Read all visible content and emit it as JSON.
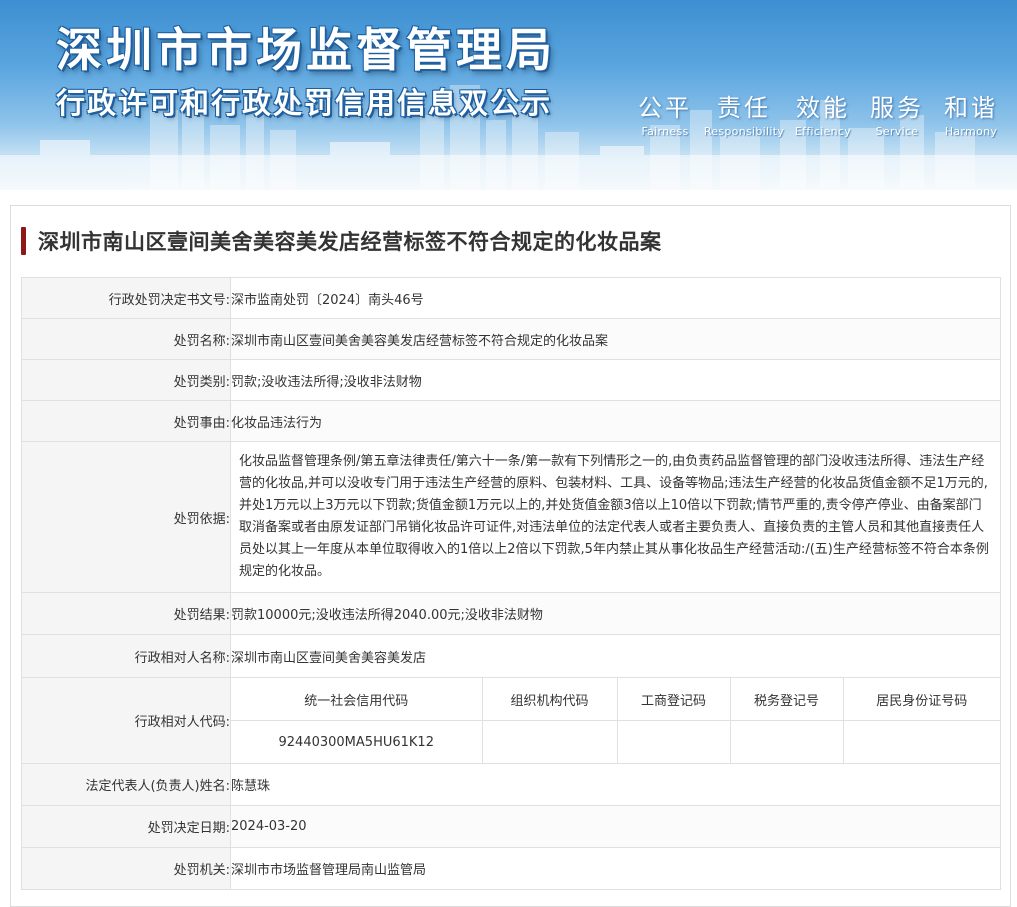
{
  "banner": {
    "title": "深圳市市场监督管理局",
    "subtitle": "行政许可和行政处罚信用信息双公示",
    "slogans": [
      {
        "cn": "公平",
        "en": "Fairness"
      },
      {
        "cn": "责任",
        "en": "Responsibility"
      },
      {
        "cn": "效能",
        "en": "Efficiency"
      },
      {
        "cn": "服务",
        "en": "Service"
      },
      {
        "cn": "和谐",
        "en": "Harmony"
      }
    ]
  },
  "case": {
    "title": "深圳市南山区壹间美舍美容美发店经营标签不符合规定的化妆品案"
  },
  "fields": {
    "doc_no": {
      "label": "行政处罚决定书文号:",
      "value": "深市监南处罚〔2024〕南头46号"
    },
    "name": {
      "label": "处罚名称:",
      "value": "深圳市南山区壹间美舍美容美发店经营标签不符合规定的化妆品案"
    },
    "category": {
      "label": "处罚类别:",
      "value": "罚款;没收违法所得;没收非法财物"
    },
    "reason": {
      "label": "处罚事由:",
      "value": "化妆品违法行为"
    },
    "basis": {
      "label": "处罚依据:",
      "value": "化妆品监督管理条例/第五章法律责任/第六十一条/第一款有下列情形之一的,由负责药品监督管理的部门没收违法所得、违法生产经营的化妆品,并可以没收专门用于违法生产经营的原料、包装材料、工具、设备等物品;违法生产经营的化妆品货值金额不足1万元的,并处1万元以上3万元以下罚款;货值金额1万元以上的,并处货值金额3倍以上10倍以下罚款;情节严重的,责令停产停业、由备案部门取消备案或者由原发证部门吊销化妆品许可证件,对违法单位的法定代表人或者主要负责人、直接负责的主管人员和其他直接责任人员处以其上一年度从本单位取得收入的1倍以上2倍以下罚款,5年内禁止其从事化妆品生产经营活动:/(五)生产经营标签不符合本条例规定的化妆品。"
    },
    "result": {
      "label": "处罚结果:",
      "value": "罚款10000元;没收违法所得2040.00元;没收非法财物"
    },
    "party_name": {
      "label": "行政相对人名称:",
      "value": "深圳市南山区壹间美舍美容美发店"
    },
    "party_code": {
      "label": "行政相对人代码:",
      "headers": [
        "统一社会信用代码",
        "组织机构代码",
        "工商登记码",
        "税务登记号",
        "居民身份证号码"
      ],
      "values": [
        "92440300MA5HU61K12",
        "",
        "",
        "",
        ""
      ]
    },
    "legal_rep": {
      "label": "法定代表人(负责人)姓名:",
      "value": "陈慧珠"
    },
    "decision_date": {
      "label": "处罚决定日期:",
      "value": "2024-03-20"
    },
    "authority": {
      "label": "处罚机关:",
      "value": "深圳市市场监督管理局南山监管局"
    }
  },
  "colors": {
    "title_accent": "#8b1a1a",
    "banner_blue": "#3d8fd1",
    "label_bg": "#f5f5f5",
    "border": "#e0e0e0"
  }
}
